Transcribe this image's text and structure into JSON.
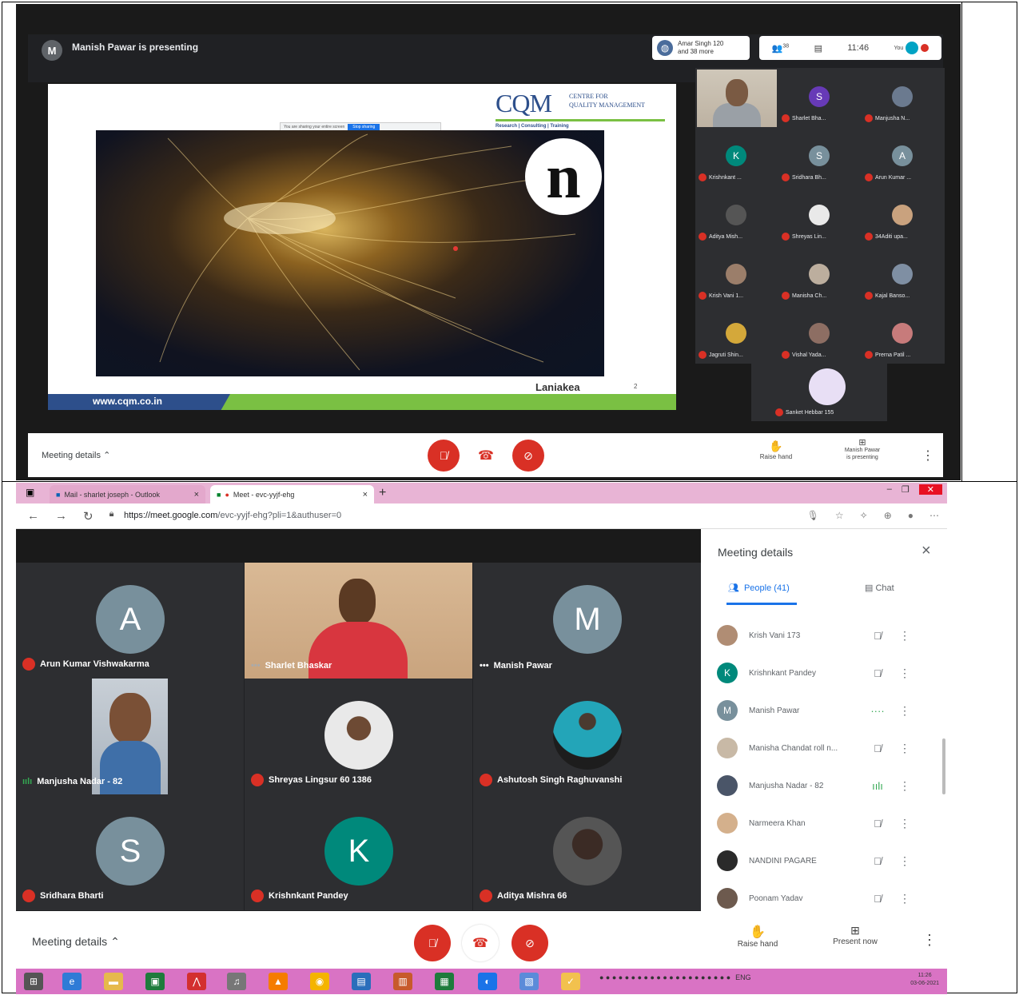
{
  "top": {
    "presenter_initial": "M",
    "presenting_text": "Manish Pawar is presenting",
    "more_text_line1": "Amar Singh 120",
    "more_text_line2": "and 38 more",
    "status_people": "38",
    "time": "11:46",
    "you_label": "You",
    "slide": {
      "logo_big": "CQM",
      "logo_side_line1": "CENTRE FOR",
      "logo_side_line2": "QUALITY MANAGEMENT",
      "logo_tagline": "Research | Consulting | Training",
      "share_text": "You are sharing your entire screen",
      "share_button": "Stop sharing",
      "n_logo": "n",
      "caption": "Laniakea",
      "page_num": "2",
      "url": "www.cqm.co.in"
    },
    "tiles": [
      {
        "name": "",
        "initial": "",
        "color": "",
        "self": true
      },
      {
        "name": "Sharlet Bha...",
        "initial": "S",
        "color": "#673ab7"
      },
      {
        "name": "Manjusha N...",
        "initial": "",
        "color": "#6b7a8f"
      },
      {
        "name": "Krishnkant ...",
        "initial": "K",
        "color": "#00897b"
      },
      {
        "name": "Sridhara Bh...",
        "initial": "S",
        "color": "#78909c"
      },
      {
        "name": "Arun Kumar ...",
        "initial": "A",
        "color": "#78909c"
      },
      {
        "name": "Aditya Mish...",
        "initial": "",
        "color": "#555"
      },
      {
        "name": "Shreyas Lin...",
        "initial": "",
        "color": "#e9e9e9"
      },
      {
        "name": "34Aditi upa...",
        "initial": "",
        "color": "#c9a27e"
      },
      {
        "name": "Krish Vani 1...",
        "initial": "",
        "color": "#9b7e6a"
      },
      {
        "name": "Manisha Ch...",
        "initial": "",
        "color": "#bcae9e"
      },
      {
        "name": "Kajal Banso...",
        "initial": "",
        "color": "#7f8fa3"
      },
      {
        "name": "Jagruti Shin...",
        "initial": "",
        "color": "#d4a83a"
      },
      {
        "name": "Vishal Yada...",
        "initial": "",
        "color": "#8d6e63"
      },
      {
        "name": "Prerna Patil ...",
        "initial": "",
        "color": "#c77b7b"
      }
    ],
    "last_tile_name": "Sanket Hebbar 155",
    "meeting_details": "Meeting details",
    "raise_hand": "Raise hand",
    "present_line1": "Manish Pawar",
    "present_line2": "is presenting"
  },
  "bottom": {
    "tabs": [
      {
        "label": "Mail - sharlet joseph - Outlook"
      },
      {
        "label": "Meet - evc-yyjf-ehg"
      }
    ],
    "url_host": "https://meet.google.com",
    "url_path": "/evc-yyjf-ehg?pli=1&authuser=0",
    "stage_tiles": [
      {
        "name": "Arun Kumar Vishwakarma",
        "initial": "A",
        "color": "#78909c",
        "kind": "avatar"
      },
      {
        "name": "Sharlet Bhaskar",
        "initial": "",
        "color": "",
        "kind": "video"
      },
      {
        "name": "Manish Pawar",
        "initial": "M",
        "color": "#78909c",
        "kind": "avatar"
      },
      {
        "name": "Manjusha Nadar - 82",
        "initial": "",
        "color": "",
        "kind": "video"
      },
      {
        "name": "Shreyas Lingsur 60 1386",
        "initial": "",
        "color": "",
        "kind": "photo"
      },
      {
        "name": "Ashutosh Singh Raghuvanshi",
        "initial": "",
        "color": "",
        "kind": "photo"
      },
      {
        "name": "Sridhara Bharti",
        "initial": "S",
        "color": "#78909c",
        "kind": "avatar"
      },
      {
        "name": "Krishnkant Pandey",
        "initial": "K",
        "color": "#00897b",
        "kind": "avatar"
      },
      {
        "name": "Aditya Mishra 66",
        "initial": "",
        "color": "",
        "kind": "photo"
      }
    ],
    "panel": {
      "title": "Meeting details",
      "people_tab": "People (41)",
      "chat_tab": "Chat",
      "people": [
        {
          "name": "Krish Vani 173",
          "initial": "",
          "color": "#b08d74",
          "state": "muted"
        },
        {
          "name": "Krishnkant Pandey",
          "initial": "K",
          "color": "#00897b",
          "state": "muted"
        },
        {
          "name": "Manish Pawar",
          "initial": "M",
          "color": "#78909c",
          "state": "speaking"
        },
        {
          "name": "Manisha Chandat roll n...",
          "initial": "",
          "color": "#c8b9a6",
          "state": "muted"
        },
        {
          "name": "Manjusha Nadar - 82",
          "initial": "",
          "color": "#4a5568",
          "state": "speaking"
        },
        {
          "name": "Narmeera Khan",
          "initial": "",
          "color": "#d4b08c",
          "state": "muted"
        },
        {
          "name": "NANDINI PAGARE",
          "initial": "",
          "color": "#2a2a2a",
          "state": "muted"
        },
        {
          "name": "Poonam Yadav",
          "initial": "",
          "color": "#6d5a4e",
          "state": "muted"
        }
      ]
    },
    "meeting_details": "Meeting details",
    "raise_hand": "Raise hand",
    "present_now": "Present now",
    "tray_lang": "ENG",
    "clock_time": "11:26",
    "clock_date": "03-06-2021"
  }
}
